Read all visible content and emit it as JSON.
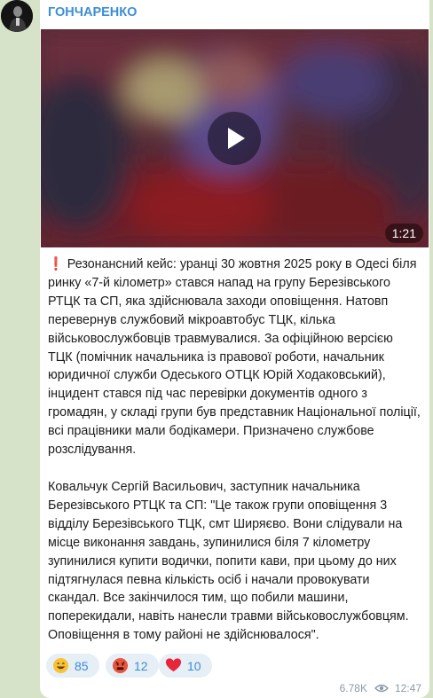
{
  "channel": {
    "name": "ГОНЧАРЕНКО"
  },
  "video": {
    "duration": "1:21"
  },
  "post": {
    "emoji": "❗",
    "paragraph1": "Резонансний кейс: уранці 30 жовтня 2025 року в Одесі біля\nринку «7-й кілометр» стався напад на групу Березівського\nРТЦК та СП, яка здійснювала заходи оповіщення. Натовп\nперевернув службовий мікроавтобус ТЦК, кілька\nвійськовослужбовців травмувалися. За офіційною версією\nТЦК (помічник начальника із правової роботи, начальник\nюридичної служби Одеського ОТЦК Юрій Ходаковський),\nінцидент стався під час перевірки документів одного з\nгромадян, у складі групи був представник Національної поліції,\nвсі працівники мали бодікамери. Призначено службове\nрозслідування.",
    "paragraph2": "Ковальчук Сергій Васильович, заступник начальника\nБерезівського РТЦК та СП: \"Це також групи оповіщення 3\nвідділу Березівського ТЦК, смт Ширяєво. Вони слідували на\nмісце виконання завдань, зупинилися біля 7 кілометру\nзупинилися купити водички, попити кави, при цьому до них\nпідтягнулася певна кількість осіб і начали провокувати\nскандал. Все закінчилося тим, що побили машини,\nпоперекидали, навіть нанесли травми військовослужбовцям.\nОповіщення в тому районі не здійснювалося\"."
  },
  "reactions": [
    {
      "icon": "grinning-face-icon",
      "count": "85"
    },
    {
      "icon": "angry-face-icon",
      "count": "12"
    },
    {
      "icon": "red-heart-icon",
      "count": "10"
    }
  ],
  "meta": {
    "views": "6.78K",
    "time": "12:47"
  }
}
